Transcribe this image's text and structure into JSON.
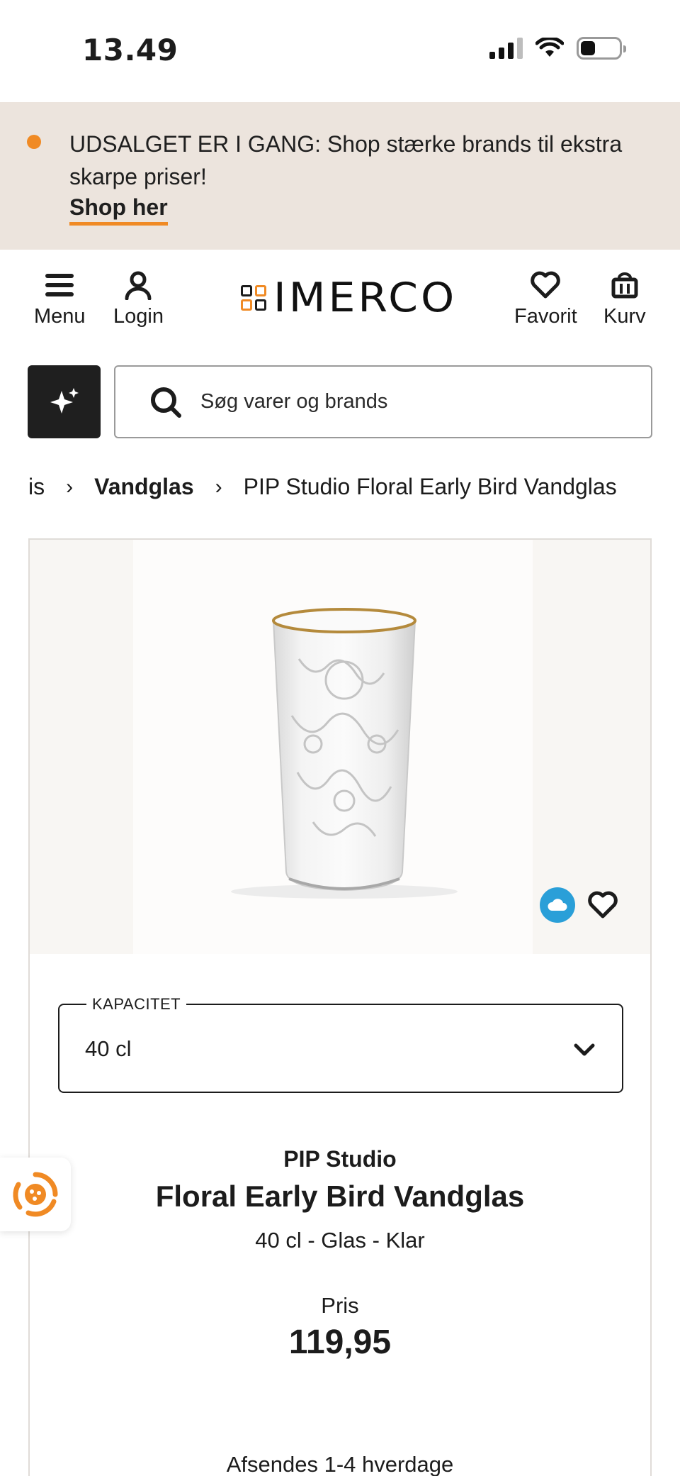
{
  "status_bar": {
    "time": "13.49",
    "icons": [
      "signal-icon",
      "wifi-icon",
      "battery-icon"
    ]
  },
  "promo": {
    "text": "UDSALGET ER I GANG: Shop stærke brands til ekstra skarpe priser!",
    "link": "Shop her",
    "accent_color": "#f08a24",
    "background_color": "#ece4dd"
  },
  "header": {
    "menu_label": "Menu",
    "login_label": "Login",
    "logo_text": "IMERCO",
    "favorite_label": "Favorit",
    "cart_label": "Kurv"
  },
  "search": {
    "placeholder": "Søg varer og brands"
  },
  "breadcrumb": {
    "partial": "is",
    "category": "Vandglas",
    "current": "PIP Studio Floral Early Bird Vandglas"
  },
  "product": {
    "capacity_label": "KAPACITET",
    "capacity_value": "40 cl",
    "brand": "PIP Studio",
    "name": "Floral Early Bird Vandglas",
    "variant": "40 cl - Glas - Klar",
    "price_label": "Pris",
    "price": "119,95",
    "shipping": "Afsendes 1-4 hverdage"
  }
}
